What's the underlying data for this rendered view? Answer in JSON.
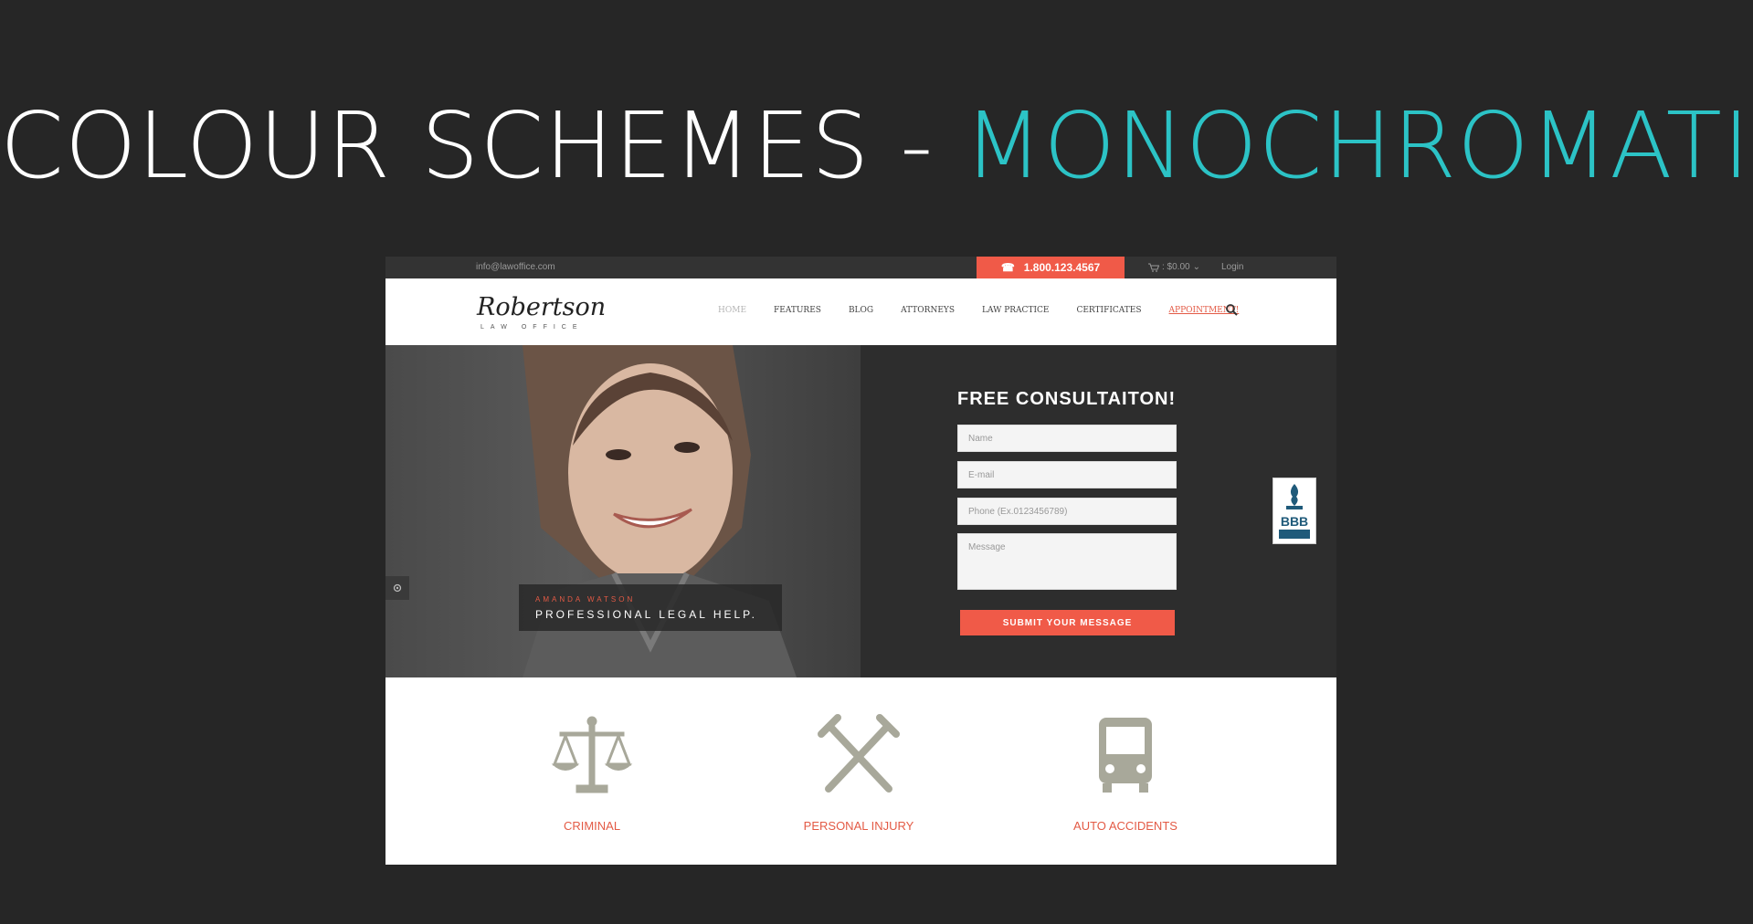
{
  "slide": {
    "title_prefix": "COLOUR SCHEMES - ",
    "title_accent": "MONOCHROMATIC"
  },
  "topbar": {
    "email": "info@lawoffice.com",
    "phone": "1.800.123.4567",
    "cart": ": $0.00",
    "login": "Login"
  },
  "header": {
    "logo": "Robertson",
    "logo_sub": "LAW OFFICE",
    "nav": [
      "HOME",
      "FEATURES",
      "BLOG",
      "ATTORNEYS",
      "LAW PRACTICE",
      "CERTIFICATES",
      "APPOINTMENT!"
    ]
  },
  "hero": {
    "caption_name": "AMANDA WATSON",
    "caption_tagline": "PROFESSIONAL LEGAL HELP.",
    "form_title": "FREE CONSULTAITON!",
    "fields": {
      "name": "Name",
      "email": "E-mail",
      "phone": "Phone (Ex.0123456789)",
      "message": "Message"
    },
    "submit": "SUBMIT YOUR MESSAGE",
    "badge": "BBB"
  },
  "services": [
    "CRIMINAL",
    "PERSONAL INJURY",
    "AUTO ACCIDENTS"
  ],
  "colors": {
    "background": "#262626",
    "accent": "#2cc3c6",
    "brand": "#f05a48"
  }
}
